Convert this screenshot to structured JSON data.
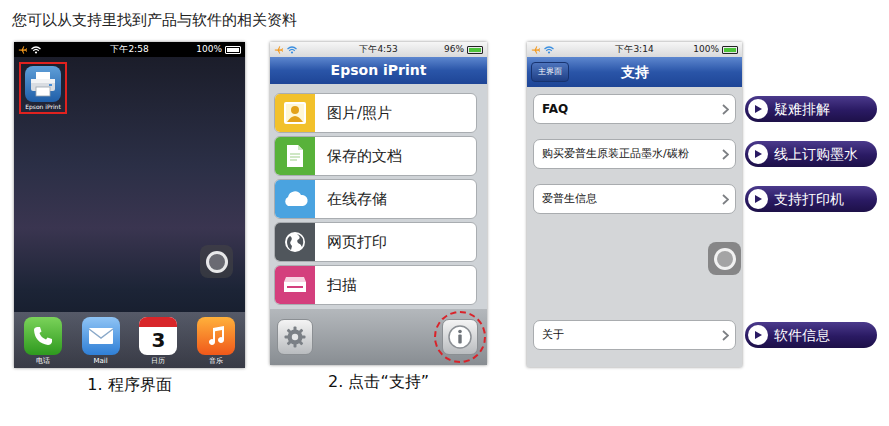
{
  "heading": "您可以从支持里找到产品与软件的相关资料",
  "home_screen": {
    "status_bar": {
      "time": "下午2:58",
      "battery": "100%",
      "level": 1
    },
    "app": {
      "label": "Epson iPrint",
      "selected": true
    },
    "dock": [
      {
        "label": "电话",
        "kind": "phone"
      },
      {
        "label": "Mail",
        "kind": "mail"
      },
      {
        "label": "日历",
        "kind": "calendar",
        "date": "3"
      },
      {
        "label": "音乐",
        "kind": "music"
      }
    ],
    "caption": "1. 程序界面"
  },
  "main_menu": {
    "status_bar": {
      "time": "下午4:53",
      "battery": "96%",
      "level": 0.96
    },
    "title": "Epson iPrint",
    "items": [
      {
        "label": "图片/照片",
        "color": "#f2c12b"
      },
      {
        "label": "保存的文档",
        "color": "#58b23a"
      },
      {
        "label": "在线存储",
        "color": "#4aa3e0"
      },
      {
        "label": "网页打印",
        "color": "#50565c"
      },
      {
        "label": "扫描",
        "color": "#d43f7d"
      }
    ],
    "info_button": {
      "selected": true
    },
    "caption": "2. 点击“支持”"
  },
  "support_screen": {
    "status_bar": {
      "time": "下午3:14",
      "battery": "100%",
      "level": 1
    },
    "back_button": "主界面",
    "title": "支持",
    "items": [
      {
        "label": "FAQ"
      },
      {
        "label": "购买爱普生原装正品墨水/碳粉"
      },
      {
        "label": "爱普生信息"
      }
    ],
    "about_item": {
      "label": "关于"
    }
  },
  "callouts": [
    {
      "label": "疑难排解"
    },
    {
      "label": "线上订购墨水"
    },
    {
      "label": "支持打印机"
    },
    {
      "label": "软件信息"
    }
  ]
}
